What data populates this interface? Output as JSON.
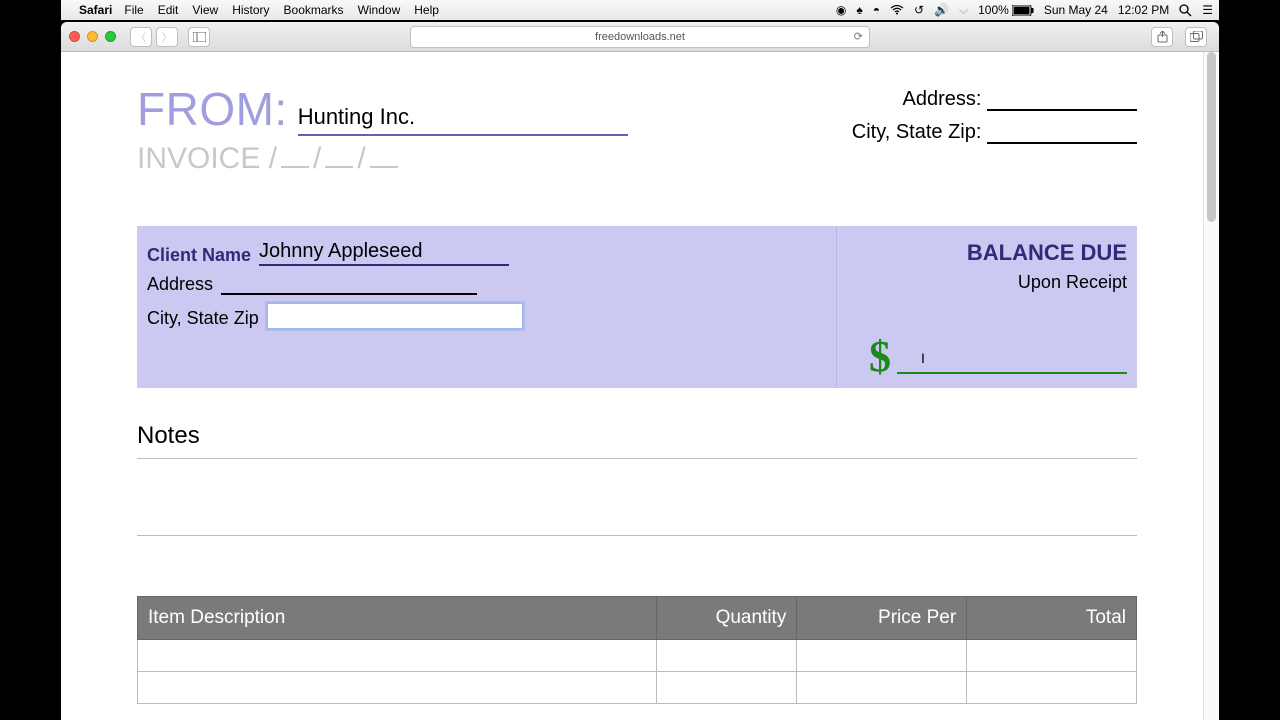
{
  "menubar": {
    "app": "Safari",
    "items": [
      "File",
      "Edit",
      "View",
      "History",
      "Bookmarks",
      "Window",
      "Help"
    ],
    "battery": "100%",
    "date": "Sun May 24",
    "time": "12:02 PM"
  },
  "browser": {
    "url": "freedownloads.net"
  },
  "invoice": {
    "from_label": "FROM:",
    "from_value": "Hunting Inc.",
    "invoice_label": "INVOICE",
    "right_labels": {
      "address": "Address:",
      "csz": "City, State Zip:"
    },
    "client": {
      "name_label": "Client Name",
      "name_value": "Johnny Appleseed",
      "address_label": "Address",
      "csz_label": "City, State Zip"
    },
    "balance": {
      "label": "BALANCE DUE",
      "terms": "Upon Receipt",
      "currency": "$"
    },
    "notes_label": "Notes",
    "table": {
      "cols": [
        "Item Description",
        "Quantity",
        "Price Per",
        "Total"
      ]
    }
  }
}
